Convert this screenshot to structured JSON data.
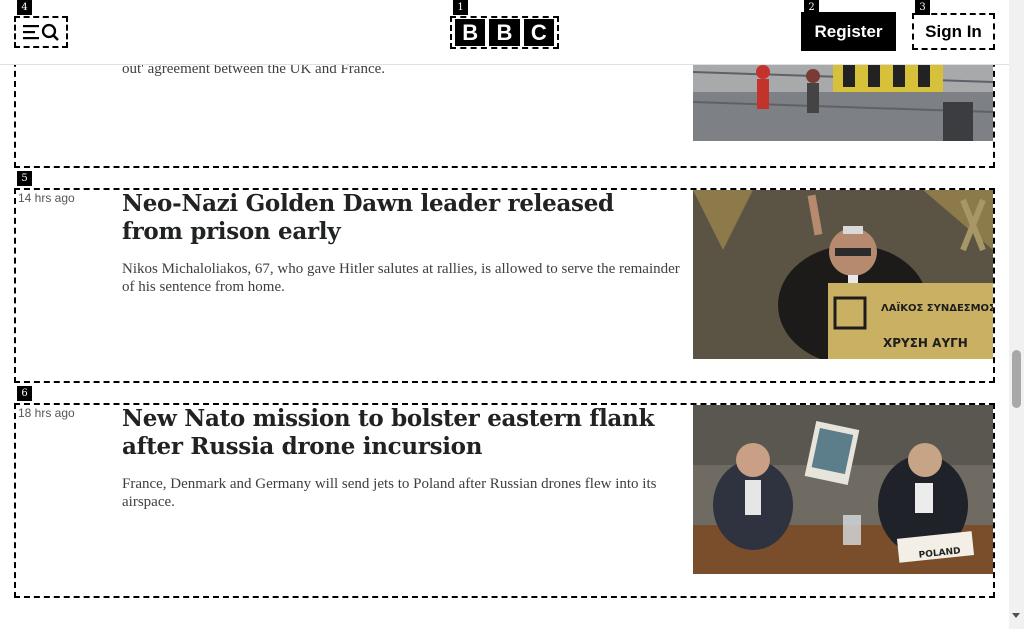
{
  "header": {
    "logo": [
      "B",
      "B",
      "C"
    ],
    "register_label": "Register",
    "signin_label": "Sign In",
    "menu_icon": "menu-search-icon"
  },
  "markers": [
    "1",
    "2",
    "3",
    "4",
    "5",
    "6"
  ],
  "articles": [
    {
      "summary": "out' agreement between the UK and France."
    },
    {
      "timestamp": "14 hrs ago",
      "headline": "Neo-Nazi Golden Dawn leader released from prison early",
      "summary": "Nikos Michaloliakos, 67, who gave Hitler salutes at rallies, is allowed to serve the remainder of his sentence from home.",
      "image_text": [
        "ΛΑΪΚΟΣ ΣΥΝΔΕΣΜΟΣ",
        "ΧΡΥΣΗ ΑΥΓΗ"
      ]
    },
    {
      "timestamp": "18 hrs ago",
      "headline": "New Nato mission to bolster eastern flank after Russia drone incursion",
      "summary": "France, Denmark and Germany will send jets to Poland after Russian drones flew into its airspace.",
      "image_text": [
        "POLAND"
      ]
    }
  ]
}
